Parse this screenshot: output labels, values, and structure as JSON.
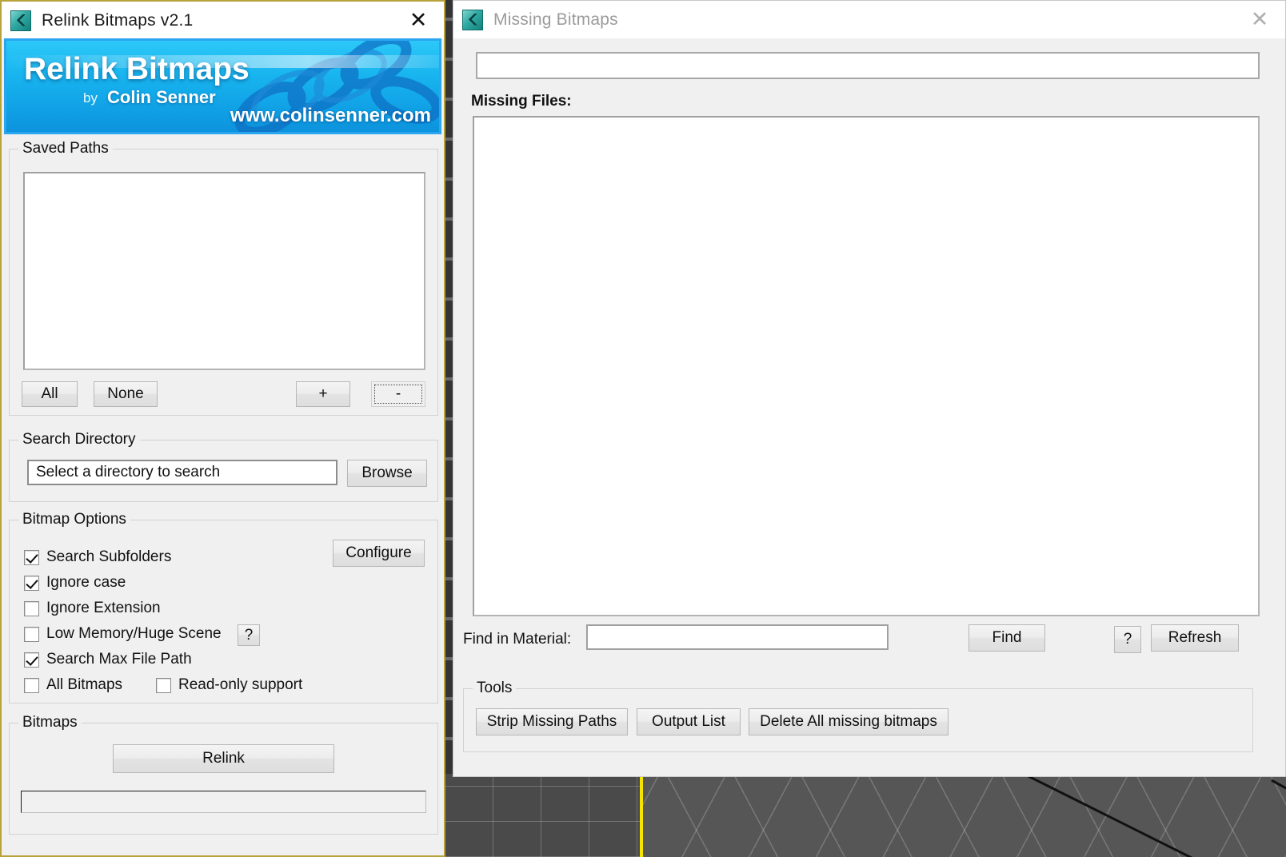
{
  "background": {
    "app": "3ds Max viewport",
    "viewport_border_color": "#f5e400"
  },
  "relink_dialog": {
    "title": "Relink Bitmaps v2.1",
    "icon": "relink-app-icon",
    "close_icon": "close-icon",
    "banner": {
      "title": "Relink Bitmaps",
      "by_prefix": "by",
      "author": "Colin Senner",
      "url": "www.colinsenner.com"
    },
    "saved_paths": {
      "legend": "Saved Paths",
      "items": [],
      "buttons": {
        "all": "All",
        "none": "None",
        "add": "+",
        "remove": "-"
      }
    },
    "search_directory": {
      "legend": "Search Directory",
      "input_value": "Select a directory to search",
      "input_placeholder": "Select a directory to search",
      "browse": "Browse"
    },
    "bitmap_options": {
      "legend": "Bitmap Options",
      "configure": "Configure",
      "help": "?",
      "checkboxes": [
        {
          "label": "Search Subfolders",
          "checked": true
        },
        {
          "label": "Ignore case",
          "checked": true
        },
        {
          "label": "Ignore Extension",
          "checked": false
        },
        {
          "label": "Low Memory/Huge Scene",
          "checked": false
        },
        {
          "label": "Search Max File Path",
          "checked": true
        },
        {
          "label": "All Bitmaps",
          "checked": false
        },
        {
          "label": "Read-only support",
          "checked": false
        }
      ]
    },
    "bitmaps": {
      "legend": "Bitmaps",
      "relink": "Relink",
      "progress_percent": 0,
      "progress_text": ""
    }
  },
  "missing_dialog": {
    "title": "Missing Bitmaps",
    "icon": "relink-app-icon",
    "close_icon": "close-icon",
    "path_input_value": "",
    "path_input_placeholder": "",
    "missing_files_label": "Missing Files:",
    "missing_files": [],
    "find_in_material_label": "Find in Material:",
    "find_in_material_value": "",
    "find_button": "Find",
    "help_button": "?",
    "refresh_button": "Refresh",
    "tools": {
      "legend": "Tools",
      "buttons": [
        "Strip Missing Paths",
        "Output List",
        "Delete All missing bitmaps"
      ]
    }
  }
}
